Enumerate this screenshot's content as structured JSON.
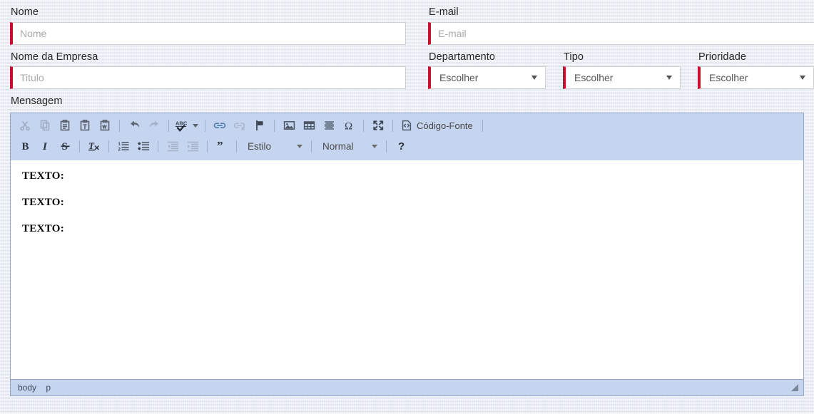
{
  "form": {
    "fields": [
      {
        "label": "Nome",
        "placeholder": "Nome",
        "value": "",
        "type": "text"
      },
      {
        "label": "E-mail",
        "placeholder": "E-mail",
        "value": "",
        "type": "text"
      },
      {
        "label": "Nome da Empresa",
        "placeholder": "Titulo",
        "value": "",
        "type": "text"
      }
    ],
    "selects": [
      {
        "label": "Departamento",
        "value": "Escolher"
      },
      {
        "label": "Tipo",
        "value": "Escolher"
      },
      {
        "label": "Prioridade",
        "value": "Escolher"
      }
    ],
    "message_label": "Mensagem"
  },
  "editor": {
    "toolbar_row1": [
      {
        "name": "cut-icon",
        "title": "Cortar",
        "disabled": true
      },
      {
        "name": "copy-icon",
        "title": "Copiar",
        "disabled": true
      },
      {
        "name": "paste-icon",
        "title": "Colar",
        "disabled": false
      },
      {
        "name": "paste-text-icon",
        "title": "Colar como texto",
        "disabled": false
      },
      {
        "name": "paste-word-icon",
        "title": "Colar do Word",
        "disabled": false
      },
      {
        "name": "undo-icon",
        "title": "Desfazer",
        "disabled": false
      },
      {
        "name": "redo-icon",
        "title": "Refazer",
        "disabled": true
      },
      {
        "name": "spellcheck-icon",
        "title": "Verificar ortografia",
        "disabled": false
      },
      {
        "name": "link-icon",
        "title": "Link",
        "disabled": false
      },
      {
        "name": "unlink-icon",
        "title": "Remover link",
        "disabled": true
      },
      {
        "name": "anchor-flag-icon",
        "title": "Âncora",
        "disabled": false
      },
      {
        "name": "image-icon",
        "title": "Imagem",
        "disabled": false
      },
      {
        "name": "table-icon",
        "title": "Tabela",
        "disabled": false
      },
      {
        "name": "horizontal-rule-icon",
        "title": "Linha horizontal",
        "disabled": false
      },
      {
        "name": "special-char-icon",
        "title": "Caractere especial",
        "disabled": false
      },
      {
        "name": "maximize-icon",
        "title": "Maximizar",
        "disabled": false
      }
    ],
    "source_button_label": "Código-Fonte",
    "toolbar_row2": [
      {
        "name": "bold-icon",
        "title": "Negrito",
        "disabled": false
      },
      {
        "name": "italic-icon",
        "title": "Itálico",
        "disabled": false
      },
      {
        "name": "strikethrough-icon",
        "title": "Tachado",
        "disabled": false
      },
      {
        "name": "remove-format-icon",
        "title": "Remover formatação",
        "disabled": false
      },
      {
        "name": "numbered-list-icon",
        "title": "Lista numerada",
        "disabled": false
      },
      {
        "name": "bulleted-list-icon",
        "title": "Lista com marcas",
        "disabled": false
      },
      {
        "name": "outdent-icon",
        "title": "Diminuir recuo",
        "disabled": true
      },
      {
        "name": "indent-icon",
        "title": "Aumentar recuo",
        "disabled": true
      },
      {
        "name": "blockquote-icon",
        "title": "Citação",
        "disabled": false
      },
      {
        "name": "help-icon",
        "title": "Ajuda",
        "disabled": false
      }
    ],
    "style_dropdown": "Estilo",
    "format_dropdown": "Normal",
    "content_paragraphs": [
      "TEXTO:",
      "TEXTO:",
      "TEXTO:"
    ],
    "status_path": [
      "body",
      "p"
    ]
  },
  "colors": {
    "accent_red": "#c8102e",
    "toolbar_bg": "#c5d4ef",
    "editor_border": "#9aa7c2",
    "page_bg": "#eef1f8"
  }
}
